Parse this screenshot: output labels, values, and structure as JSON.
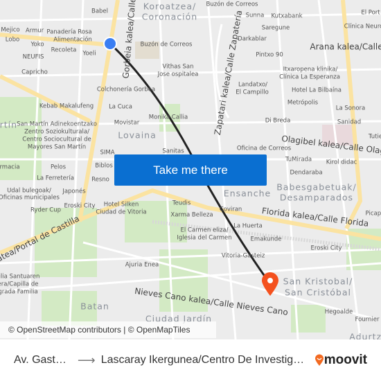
{
  "map": {
    "labels": [
      "Babel",
      "Koroatzea/",
      "Coronación",
      "Mejico",
      "Armur",
      "Panadería Rosa",
      "Alimentación",
      "Lobo",
      "Yoko",
      "Recoleta",
      "Yoeli",
      "NEUFIS",
      "Capricho",
      "Gorbeia kalea/Calle",
      "Buzón de Correos",
      "Vithas San",
      "Jose ospitalea",
      "Colchonería Gorbea",
      "La Cuca",
      "Kebab Makalufeng",
      "Monika Callia",
      "Movistar",
      "Lovaina",
      "San Martín Adinekoentzako",
      "Zentro Soziokulturala/",
      "Centro Sociocultural de",
      "Mayores San Martín",
      "SIMA",
      "Sanitas",
      "Biblos",
      "Pelos",
      "La Ferretería",
      "Resno",
      "Udal bulegoak/",
      "Oficinas municipales",
      "Japonés",
      "Eroski City",
      "Ryder Cup",
      "Hotel Silken",
      "Ciudad de Vitoria",
      "Teudis",
      "Xarma Belleza",
      "El Carmen eliza/",
      "Iglesia del Carmen",
      "Ajuria Enea",
      "Batan",
      "Nieves Cano kalea/Calle Nieves Cano",
      "Ciudad Jardín",
      "Sunna",
      "Kutxabank",
      "Saregune",
      "Darkablar",
      "Zapatari kalea/Calle Zapatería",
      "Pintxo 90",
      "Arana kalea/Calle",
      "Itxaropena klinika/",
      "Clínica La Esperanza",
      "Landatxo/",
      "El Campillo",
      "Hotel La Bilbaína",
      "Metrópolis",
      "Di Breda",
      "La Sonora",
      "Sanidad",
      "Olagibel kalea/Calle Olagu",
      "Oficina de Correos",
      "TuMirada",
      "Kirol didac",
      "Dendaraba",
      "Babesgabetuak/",
      "Desamparados",
      "Ensanche",
      "Coviran",
      "Florida kalea/Calle Florida",
      "La Huerta",
      "Emakunde",
      "Vitoria-Gasteiz",
      "Eroski City",
      "San Kristobal/",
      "San Cristóbal",
      "Hegoalde",
      "Fournier",
      "Adurtza",
      "El Port",
      "Clínica Neuro",
      "Picapi",
      "Tutie",
      "atea/Portal de Castilla",
      "ilia Santuaren",
      "era/Capilla de",
      "grada Familia",
      "rmacia",
      "artín",
      "Buzón de Correos"
    ],
    "cta_label": "Take me there",
    "attribution": "© OpenStreetMap contributors | © OpenMapTiles",
    "colors": {
      "route": "#222222",
      "origin": "#3a7ef2",
      "destination": "#f4511e",
      "cta": "#0a6fd1",
      "major_road": "#fbe3a1",
      "park": "#cfe8c0"
    }
  },
  "footer": {
    "from": "Av. Gast…",
    "to": "Lascaray Ikergunea/Centro De Investig…",
    "brand": "moovit",
    "brand_color": "#f26a21"
  }
}
